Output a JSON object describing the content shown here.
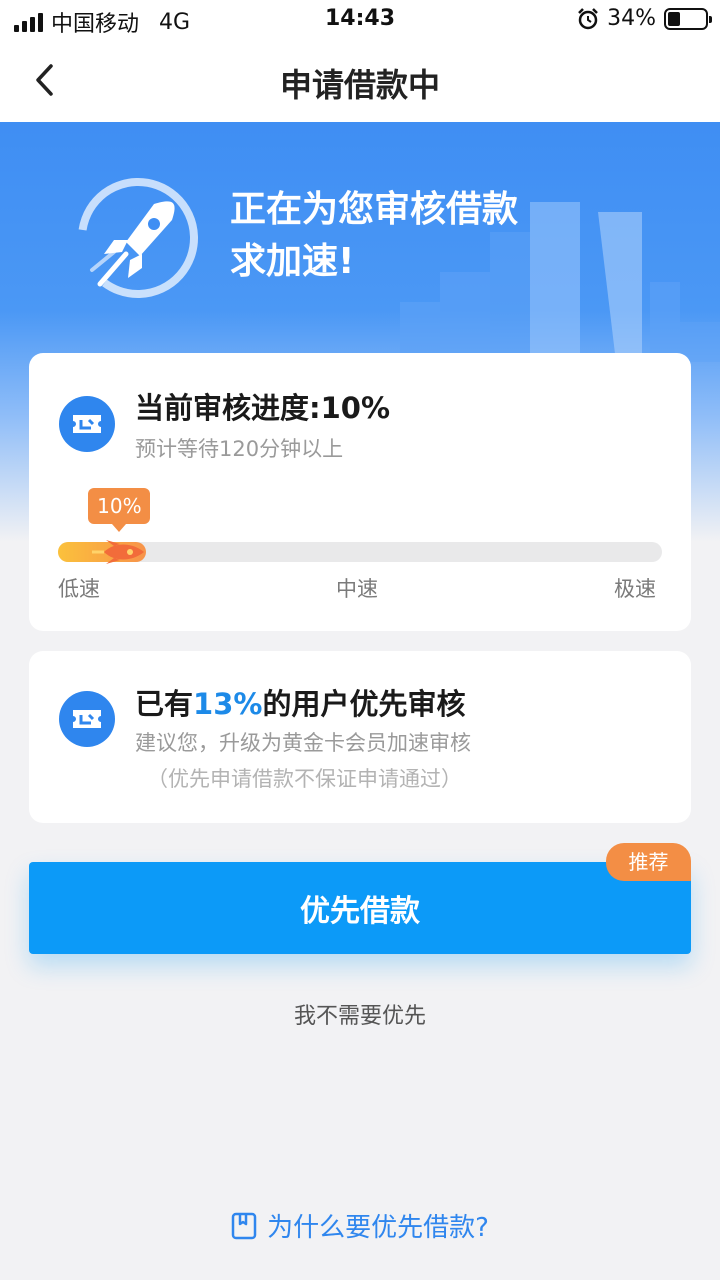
{
  "status_bar": {
    "carrier": "中国移动",
    "network": "4G",
    "time": "14:43",
    "battery": "34%",
    "battery_level": 0.34
  },
  "nav": {
    "title": "申请借款中",
    "back_icon": "chevron-left-icon"
  },
  "hero": {
    "line1": "正在为您审核借款",
    "line2": "求加速!"
  },
  "progress_card": {
    "title": "当前审核进度:10%",
    "subtitle": "预计等待120分钟以上",
    "progress_percent": 10,
    "progress_label": "10%",
    "speed_labels": [
      "低速",
      "中速",
      "极速"
    ]
  },
  "priority_card": {
    "title_prefix": "已有",
    "title_highlight": "13%",
    "title_suffix": "的用户优先审核",
    "line1": "建议您，升级为黄金卡会员加速审核",
    "line2": "（优先申请借款不保证申请通过）"
  },
  "actions": {
    "primary": "优先借款",
    "badge": "推荐",
    "secondary": "我不需要优先"
  },
  "footer": {
    "help_link": "为什么要优先借款?"
  },
  "colors": {
    "accent": "#0c9af8",
    "hero_blue": "#3f8ef3",
    "orange": "#f38e45",
    "link_blue": "#2f86ee"
  }
}
